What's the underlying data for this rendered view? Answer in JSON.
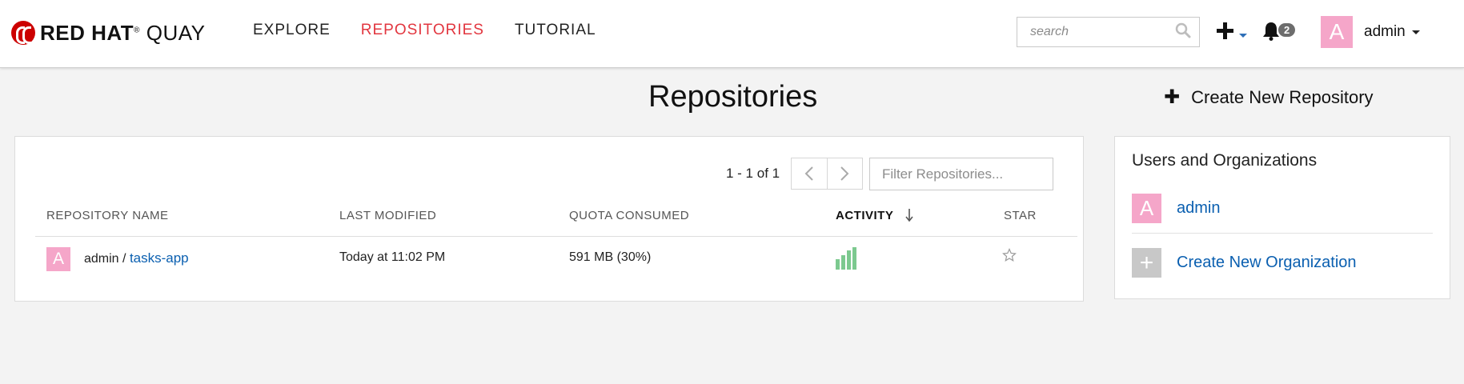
{
  "brand": {
    "bold": "RED HAT",
    "rest": "QUAY",
    "reg": "®"
  },
  "nav": {
    "explore": "EXPLORE",
    "repositories": "REPOSITORIES",
    "tutorial": "TUTORIAL"
  },
  "search": {
    "placeholder": "search",
    "value": ""
  },
  "notifications": {
    "count": "2"
  },
  "user": {
    "initial": "A",
    "name": "admin"
  },
  "page": {
    "title": "Repositories",
    "create_repo": "Create New Repository"
  },
  "repos": {
    "pagination": "1 - 1 of 1",
    "filter_placeholder": "Filter Repositories...",
    "columns": {
      "name": "REPOSITORY NAME",
      "modified": "LAST MODIFIED",
      "quota": "QUOTA CONSUMED",
      "activity": "ACTIVITY",
      "star": "STAR"
    },
    "rows": [
      {
        "avatar": "A",
        "namespace": "admin",
        "separator": "/",
        "name": "tasks-app",
        "modified": "Today at 11:02 PM",
        "quota": "591 MB (30%)",
        "activity_levels": [
          0.45,
          0.65,
          0.85,
          1.0
        ],
        "starred": false
      }
    ]
  },
  "orgs": {
    "title": "Users and Organizations",
    "items": [
      {
        "initial": "A",
        "label": "admin"
      },
      {
        "initial": "+",
        "label": "Create New Organization"
      }
    ]
  },
  "colors": {
    "accent": "#e2363f",
    "link": "#0a5fb0",
    "avatar": "#f5a6c9",
    "activity": "#7cc98f"
  }
}
